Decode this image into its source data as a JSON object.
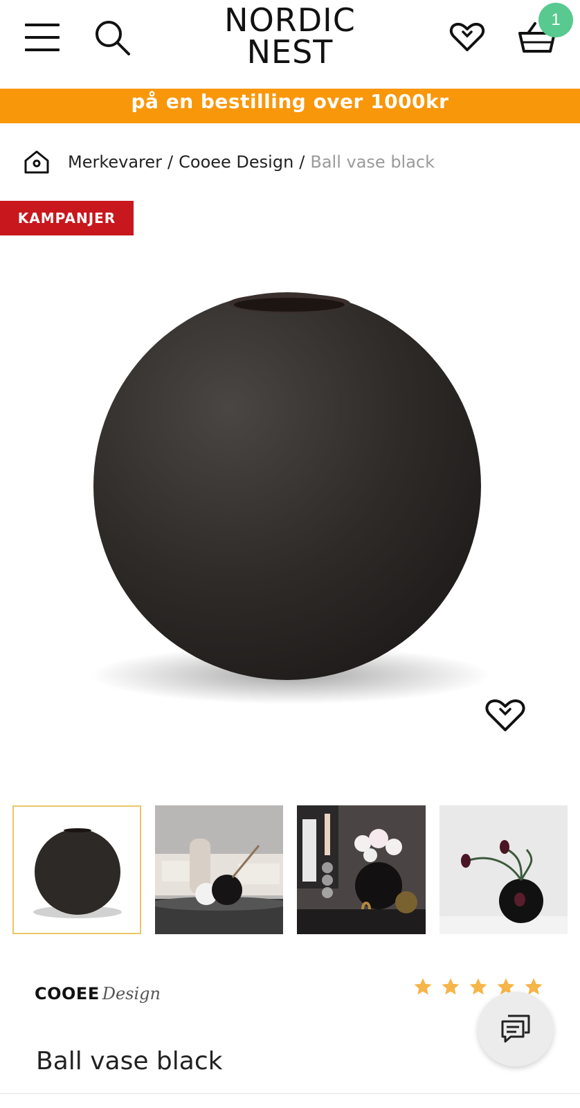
{
  "header": {
    "logo_line1": "NORDIC",
    "logo_line2": "NEST",
    "cart_count": "1",
    "icons": [
      "menu-icon",
      "search-icon",
      "heart-icon",
      "basket-icon"
    ]
  },
  "promo_banner": {
    "text": "på en bestilling over 1000kr"
  },
  "breadcrumb": {
    "items": [
      "Merkevarer",
      "Cooee Design"
    ],
    "separator": "/",
    "current": "Ball vase black"
  },
  "product": {
    "badge": "KAMPANJER",
    "brand": "COOEE",
    "brand_script": "Design",
    "title": "Ball vase black",
    "rating": 5,
    "thumbnails": [
      "ball-vase-product",
      "living-room-scene",
      "vase-with-flowers-scene",
      "vase-with-tulips-scene"
    ]
  },
  "colors": {
    "promo": "#f9970a",
    "badge": "#c8171d",
    "cart_badge": "#58c98f",
    "star": "#f5b548",
    "thumb_selected": "#e9c66a"
  }
}
